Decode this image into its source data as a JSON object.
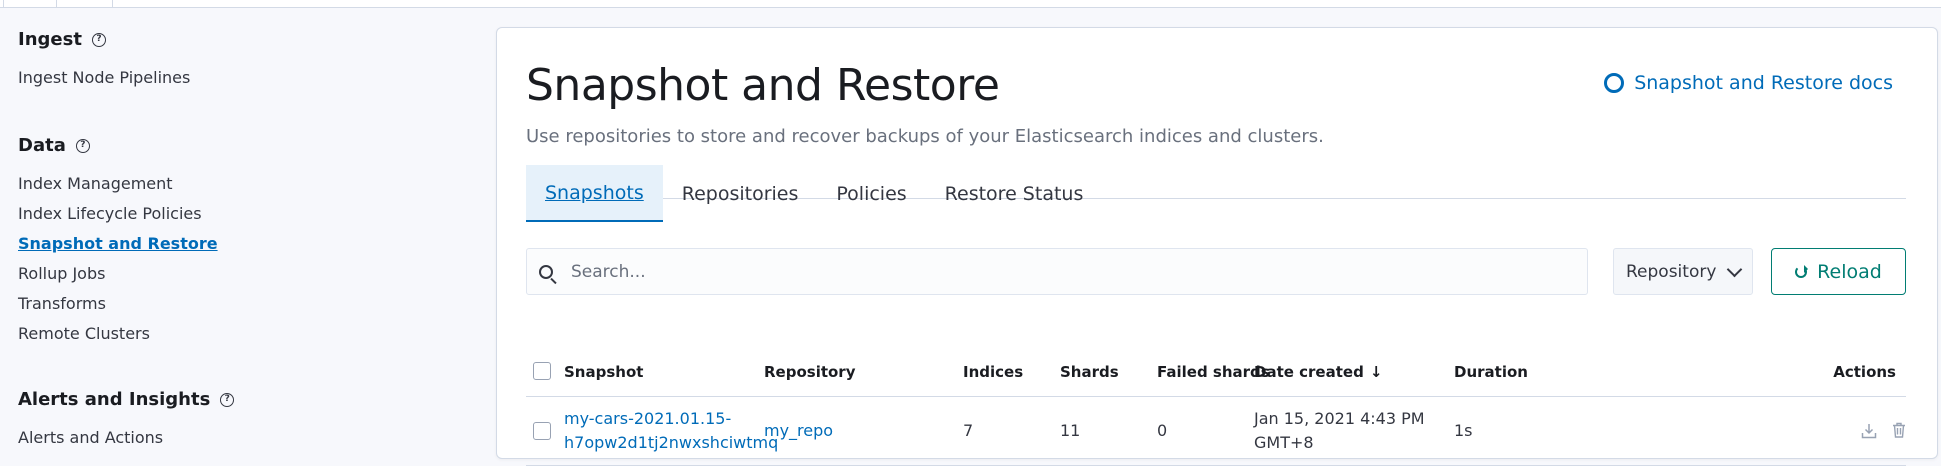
{
  "sidebar": {
    "groups": [
      {
        "title": "Ingest",
        "items": [
          "Ingest Node Pipelines"
        ]
      },
      {
        "title": "Data",
        "items": [
          "Index Management",
          "Index Lifecycle Policies",
          "Snapshot and Restore",
          "Rollup Jobs",
          "Transforms",
          "Remote Clusters"
        ]
      },
      {
        "title": "Alerts and Insights",
        "items": [
          "Alerts and Actions"
        ]
      }
    ],
    "active_item": "Snapshot and Restore"
  },
  "header": {
    "title": "Snapshot and Restore",
    "docs_link": "Snapshot and Restore docs",
    "subtitle": "Use repositories to store and recover backups of your Elasticsearch indices and clusters."
  },
  "tabs": [
    "Snapshots",
    "Repositories",
    "Policies",
    "Restore Status"
  ],
  "selected_tab": "Snapshots",
  "toolbar": {
    "search_placeholder": "Search...",
    "repository_filter": "Repository",
    "reload_label": "Reload"
  },
  "table": {
    "columns": [
      "Snapshot",
      "Repository",
      "Indices",
      "Shards",
      "Failed shards",
      "Date created",
      "Duration",
      "Actions"
    ],
    "sorted_column": "Date created",
    "sort_direction": "descending",
    "rows": [
      {
        "snapshot_line1": "my-cars-2021.01.15-",
        "snapshot_line2": "h7opw2d1tj2nwxshciwtmq",
        "repository": "my_repo",
        "indices": "7",
        "shards": "11",
        "failed_shards": "0",
        "date_line1": "Jan 15, 2021 4:43 PM",
        "date_line2": "GMT+8",
        "duration": "1s"
      }
    ]
  },
  "colors": {
    "link": "#006bb8",
    "reload": "#017d73",
    "selected_tab_bg": "#e6f1fa",
    "page_bg": "#f7f8fc"
  },
  "icons": [
    "help-icon",
    "lifebuoy-icon",
    "search-icon",
    "chevron-down-icon",
    "refresh-icon",
    "arrow-down-icon",
    "download-icon",
    "trash-icon"
  ]
}
